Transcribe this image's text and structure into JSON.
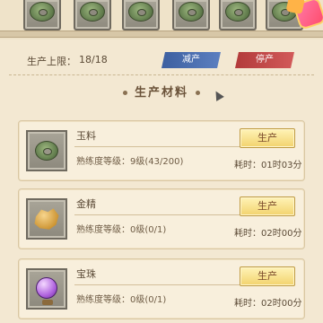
{
  "top_slots": [
    {
      "icon": "jade-disc-icon"
    },
    {
      "icon": "jade-disc-icon"
    },
    {
      "icon": "jade-disc-icon"
    },
    {
      "icon": "jade-disc-icon"
    },
    {
      "icon": "jade-disc-icon"
    },
    {
      "icon": "jade-disc-icon"
    }
  ],
  "capacity": {
    "label": "生产上限：",
    "value": "18/18",
    "btn_decrease": "减产",
    "btn_stop": "停产"
  },
  "section": {
    "title": "生产材料"
  },
  "materials": [
    {
      "name": "玉料",
      "level": "熟练度等级：9级(43/200)",
      "button": "生产",
      "time": "耗时：01时03分",
      "icon": "jade-disc-icon"
    },
    {
      "name": "金精",
      "level": "熟练度等级：0级(0/1)",
      "button": "生产",
      "time": "耗时：02时00分",
      "icon": "gold-ore-icon"
    },
    {
      "name": "宝珠",
      "level": "熟练度等级：0级(0/1)",
      "button": "生产",
      "time": "耗时：02时00分",
      "icon": "purple-pearl-icon"
    }
  ],
  "colors": {
    "background": "#f3e8d2",
    "card": "#f8efdc",
    "button_gold": "#f2d36d",
    "ribbon_blue": "#3c5fa0",
    "ribbon_red": "#b23a3a"
  }
}
